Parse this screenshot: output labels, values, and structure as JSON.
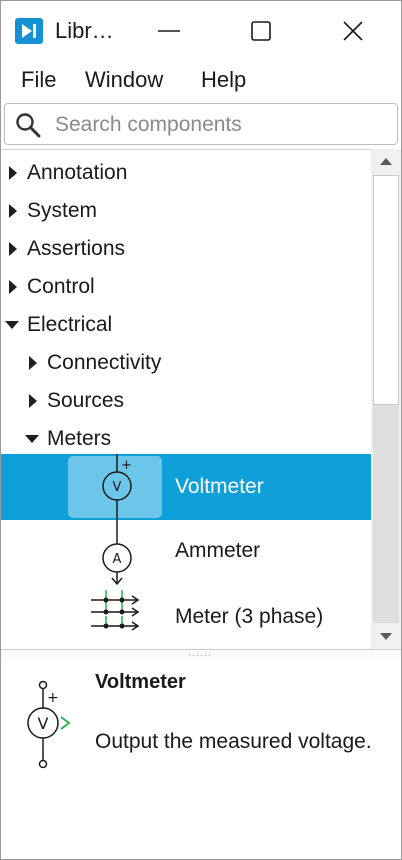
{
  "window": {
    "title": "Libr…"
  },
  "colors": {
    "accent": "#0f9fd9",
    "selected_symbol_bg": "#6cc6ea",
    "app_icon": "#1592d6",
    "signal_green": "#22b34a"
  },
  "menu": {
    "items": [
      "File",
      "Window",
      "Help"
    ]
  },
  "search": {
    "placeholder": "Search components",
    "value": ""
  },
  "tree": {
    "categories": [
      {
        "label": "Annotation",
        "expanded": false
      },
      {
        "label": "System",
        "expanded": false
      },
      {
        "label": "Assertions",
        "expanded": false
      },
      {
        "label": "Control",
        "expanded": false
      },
      {
        "label": "Electrical",
        "expanded": true
      }
    ],
    "subcategories": [
      {
        "label": "Connectivity",
        "expanded": false
      },
      {
        "label": "Sources",
        "expanded": false
      },
      {
        "label": "Meters",
        "expanded": true
      }
    ],
    "components": [
      {
        "label": "Voltmeter",
        "icon": "voltmeter-icon",
        "selected": true
      },
      {
        "label": "Ammeter",
        "icon": "ammeter-icon",
        "selected": false
      },
      {
        "label": "Meter (3 phase)",
        "icon": "three-phase-meter-icon",
        "selected": false
      }
    ]
  },
  "detail": {
    "title": "Voltmeter",
    "description": "Output the measured voltage.",
    "icon": "voltmeter-icon"
  }
}
